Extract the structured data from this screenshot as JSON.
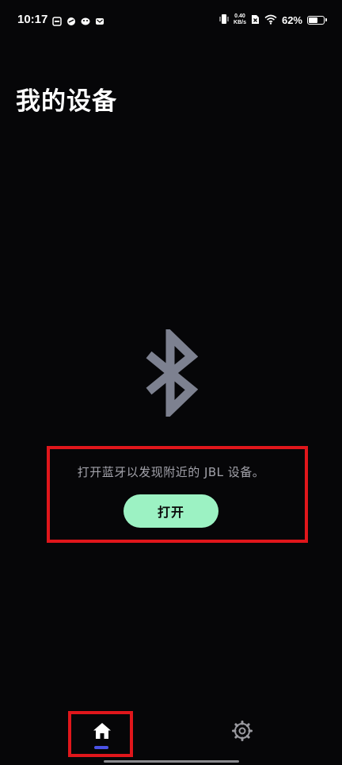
{
  "status_bar": {
    "time": "10:17",
    "net_speed_value": "0.40",
    "net_speed_unit": "KB/s",
    "battery_percent": "62%",
    "battery_level": 0.62,
    "notification_icons": [
      "card-notification-icon",
      "app-notification-icon",
      "smile-notification-icon",
      "mail-notification-icon"
    ],
    "system_icons": [
      "vibrate-icon",
      "sim-blocked-icon",
      "wifi-icon",
      "battery-icon"
    ]
  },
  "page": {
    "title": "我的设备"
  },
  "bluetooth_prompt": {
    "icon": "bluetooth-icon",
    "message": "打开蓝牙以发现附近的 JBL 设备。",
    "button_label": "打开"
  },
  "bottom_nav": {
    "items": [
      {
        "icon": "home-icon",
        "active": true
      },
      {
        "icon": "gear-icon",
        "active": false
      }
    ]
  },
  "colors": {
    "background": "#060608",
    "accent_button": "#9cf2c3",
    "active_indicator": "#4b52e6",
    "highlight": "#e0161b",
    "bluetooth_icon": "#7d8190"
  }
}
